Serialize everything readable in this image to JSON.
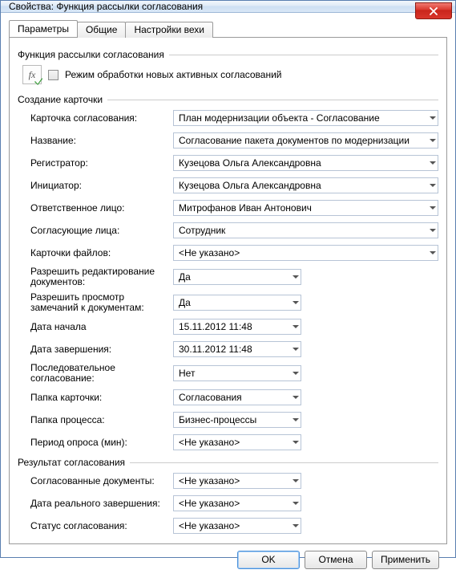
{
  "window": {
    "title": "Свойства: Функция рассылки согласования"
  },
  "tabs": {
    "items": [
      {
        "label": "Параметры"
      },
      {
        "label": "Общие"
      },
      {
        "label": "Настройки вехи"
      }
    ]
  },
  "group1": {
    "title": "Функция рассылки согласования",
    "checkbox_label": "Режим обработки новых активных согласований",
    "fx_text": "fx"
  },
  "group2": {
    "title": "Создание карточки",
    "rows": {
      "card": {
        "label": "Карточка согласования:",
        "value": "План модернизации объекта - Согласование"
      },
      "name": {
        "label": "Название:",
        "value": "Согласование пакета документов по модернизации"
      },
      "registrar": {
        "label": "Регистратор:",
        "value": "Кузецова Ольга Александровна"
      },
      "initiator": {
        "label": "Инициатор:",
        "value": "Кузецова Ольга Александровна"
      },
      "responsible": {
        "label": "Ответственное лицо:",
        "value": "Митрофанов Иван Антонович"
      },
      "approvers": {
        "label": "Согласующие лица:",
        "value": "Сотрудник"
      },
      "filecards": {
        "label": "Карточки файлов:",
        "value": "<Не указано>"
      },
      "allowEdit": {
        "label": "Разрешить редактирование документов:",
        "value": "Да"
      },
      "allowView": {
        "label": "Разрешить просмотр замечаний к документам:",
        "value": "Да"
      },
      "startDate": {
        "label": "Дата начала",
        "value": "15.11.2012 11:48"
      },
      "endDate": {
        "label": "Дата завершения:",
        "value": "30.11.2012 11:48"
      },
      "sequential": {
        "label": "Последовательное согласование:",
        "value": "Нет"
      },
      "cardFolder": {
        "label": "Папка карточки:",
        "value": "Согласования"
      },
      "procFolder": {
        "label": "Папка процесса:",
        "value": "Бизнес-процессы"
      },
      "pollPeriod": {
        "label": "Период опроса (мин):",
        "value": "<Не указано>"
      }
    }
  },
  "group3": {
    "title": "Результат согласования",
    "rows": {
      "docs": {
        "label": "Согласованные документы:",
        "value": "<Не указано>"
      },
      "realEnd": {
        "label": "Дата реального завершения:",
        "value": "<Не указано>"
      },
      "status": {
        "label": "Статус согласования:",
        "value": "<Не указано>"
      }
    }
  },
  "buttons": {
    "ok": "OK",
    "cancel": "Отмена",
    "apply": "Применить"
  }
}
